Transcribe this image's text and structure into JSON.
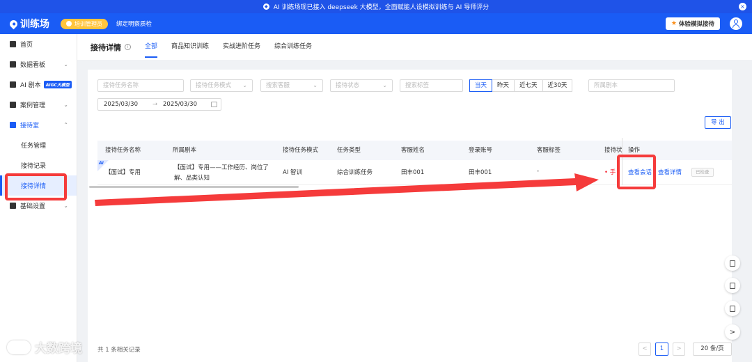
{
  "announcement": {
    "text": "AI 训练场现已接入 deepseek 大模型，全面赋能人设模拟训练与 AI 导师评分",
    "close_glyph": "×"
  },
  "header": {
    "logo_text": "训练场",
    "role_badge": "培训管理员",
    "bind_link": "绑定明察质检",
    "trial_button": "体验模拟接待",
    "trial_icon": "★"
  },
  "sidebar": {
    "items": [
      {
        "label": "首页"
      },
      {
        "label": "数据看板",
        "chevron": "⌄"
      },
      {
        "label": "AI 剧本",
        "tag": "AIGC大模型"
      },
      {
        "label": "案例管理",
        "chevron": "⌄"
      },
      {
        "label": "接待室",
        "chevron": "⌃"
      },
      {
        "label": "基础设置",
        "chevron": "⌄"
      }
    ],
    "sub_items": [
      {
        "label": "任务管理"
      },
      {
        "label": "接待记录"
      },
      {
        "label": "接待详情"
      }
    ]
  },
  "tabs": {
    "page_title": "接待详情",
    "info_glyph": "i",
    "items": [
      {
        "label": "全部"
      },
      {
        "label": "商品知识训练"
      },
      {
        "label": "实战进阶任务"
      },
      {
        "label": "综合训练任务"
      }
    ]
  },
  "filters": {
    "task_name_placeholder": "接待任务名称",
    "task_mode_placeholder": "接待任务模式",
    "agent_placeholder": "搜索客服",
    "status_placeholder": "接待状态",
    "tag_placeholder": "搜索标签",
    "script_placeholder": "所属剧本",
    "dropdown_glyph": "⌄",
    "date_options": [
      {
        "label": "当天"
      },
      {
        "label": "昨天"
      },
      {
        "label": "近七天"
      },
      {
        "label": "近30天"
      }
    ],
    "date_start": "2025/03/30",
    "date_arrow": "→",
    "date_end": "2025/03/30",
    "export_label": "导 出"
  },
  "table": {
    "columns": [
      "接待任务名称",
      "所属剧本",
      "接待任务模式",
      "任务类型",
      "客服姓名",
      "登录账号",
      "客服标签",
      "接待状",
      "操作"
    ],
    "row": {
      "ai_tag": "AI",
      "task_name": "【面试】专用",
      "script_line1": "【面试】专用——工作经历、岗位了",
      "script_line2": "解、品类认知",
      "mode": "AI 智训",
      "type": "综合训练任务",
      "agent_name": "田丰001",
      "account": "田丰001",
      "agent_tag": "-",
      "status": "• 手",
      "action_view_session": "查看会话",
      "action_view_detail": "查看详情",
      "checked_tag": "已检查"
    }
  },
  "footer": {
    "total_text": "共 1 条相关记录",
    "prev_glyph": "<",
    "page": "1",
    "next_glyph": ">",
    "page_size": "20 条/页"
  },
  "float_tools": {
    "expand_glyph": ">"
  },
  "watermark": {
    "text": "大数跨境"
  },
  "colors": {
    "brand_blue": "#1a5cf5",
    "annotation_red": "#f53b3b",
    "badge_yellow": "#ffc53d"
  }
}
